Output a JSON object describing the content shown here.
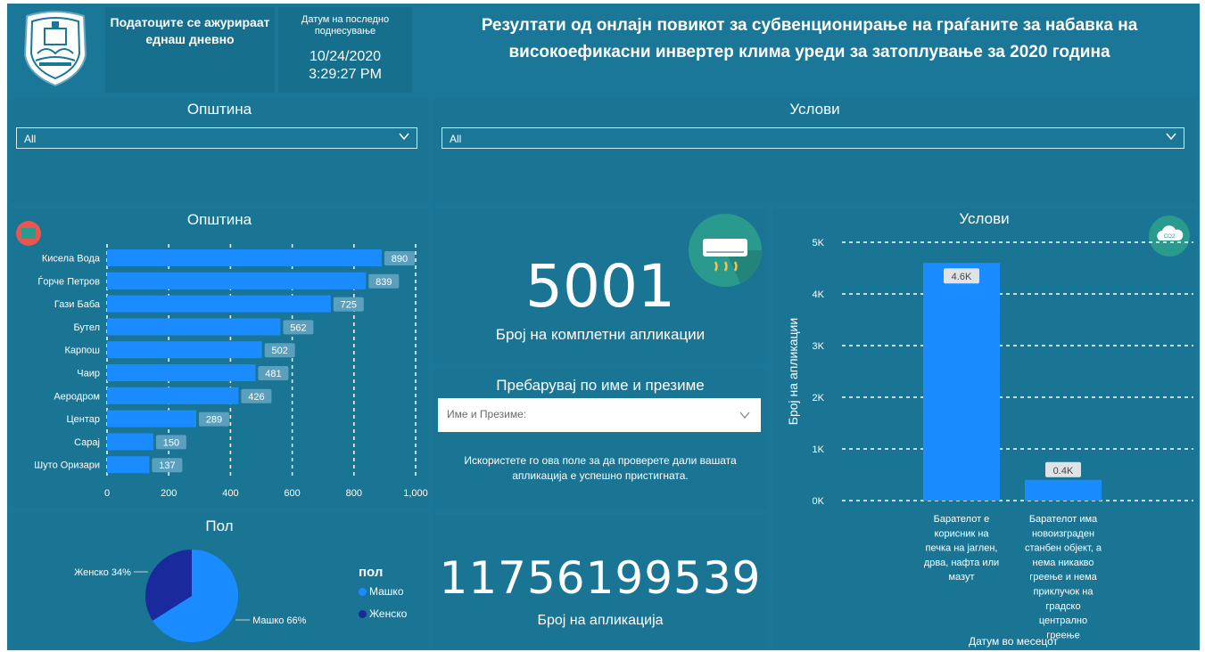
{
  "header": {
    "update_note": "Податоците се ажурираат еднаш дневно",
    "date_label": "Датум на последно поднесување",
    "date_value": "10/24/2020",
    "time_value": "3:29:27 PM",
    "title": "Резултати од онлајн повикот за субвенционирање на граѓаните за набавка на високоефикасни инвертер клима уреди за затоплување за 2020 година"
  },
  "slicers": {
    "municipality": {
      "title": "Општина",
      "value": "All"
    },
    "conditions": {
      "title": "Услови",
      "value": "All"
    }
  },
  "municipality_chart": {
    "title": "Општина"
  },
  "kpi_complete": {
    "value": "5001",
    "label": "Број на комплетни апликации"
  },
  "search": {
    "title": "Пребарувај по име и презиме",
    "placeholder": "Име и Презиме:",
    "note": "Искористете го ова поле за да проверете дали вашата апликација е успешно пристигната."
  },
  "kpi_application": {
    "value": "11756199539",
    "label": "Број на апликација"
  },
  "gender_chart": {
    "title": "Пол",
    "legend_title": "пол"
  },
  "conditions_chart": {
    "title": "Услови",
    "x_title": "Датум во месецот"
  },
  "colors": {
    "background": "#1b7797",
    "bar": "#1a8cff",
    "female": "#1a2a9c",
    "male": "#1a8cff",
    "label_bg": "#5a9fbd"
  },
  "icons": {
    "logo": "coat-of-arms-icon",
    "map": "map-badge-icon",
    "ac": "air-conditioner-icon",
    "co2": "co2-cloud-icon"
  },
  "chart_data": [
    {
      "type": "bar",
      "orientation": "horizontal",
      "title": "Општина",
      "categories": [
        "Кисела Вода",
        "Ѓорче Петров",
        "Гази Баба",
        "Бутел",
        "Карпош",
        "Чаир",
        "Аеродром",
        "Центар",
        "Сарај",
        "Шуто Оризари"
      ],
      "values": [
        890,
        839,
        725,
        562,
        502,
        481,
        426,
        289,
        150,
        137
      ],
      "value_labels": [
        "890",
        "839",
        "725",
        "562",
        "502",
        "481",
        "426",
        "289",
        "150",
        "137"
      ],
      "xlim": [
        0,
        1000
      ],
      "ticks": [
        "0",
        "200",
        "400",
        "600",
        "800",
        "1,000"
      ],
      "tick_values": [
        0,
        200,
        400,
        600,
        800,
        1000
      ],
      "grid": true
    },
    {
      "type": "pie",
      "title": "Пол",
      "legend_title": "пол",
      "legend": [
        "Машко",
        "Женско"
      ],
      "slices": [
        {
          "name": "Машко",
          "value": 66,
          "label": "Машко 66%"
        },
        {
          "name": "Женско",
          "value": 34,
          "label": "Женско 34%"
        }
      ]
    },
    {
      "type": "bar",
      "title": "Услови",
      "ylabel": "Број на апликации",
      "xlabel": "Датум во месецот",
      "categories": [
        [
          "Барателот е",
          "корисник на",
          "печка на јаглен,",
          "дрва, нафта или",
          "мазут"
        ],
        [
          "Барателот има",
          "новоизграден",
          "станбен објект, а",
          "нема никакво",
          "греење и нема",
          "приклучок на",
          "градско",
          "централно",
          "греење"
        ]
      ],
      "values": [
        4600,
        400
      ],
      "value_labels": [
        "4.6K",
        "0.4K"
      ],
      "ylim": [
        0,
        5000
      ],
      "ticks": [
        "0K",
        "1K",
        "2K",
        "3K",
        "4K",
        "5K"
      ],
      "tick_values": [
        0,
        1000,
        2000,
        3000,
        4000,
        5000
      ],
      "grid": true
    }
  ]
}
